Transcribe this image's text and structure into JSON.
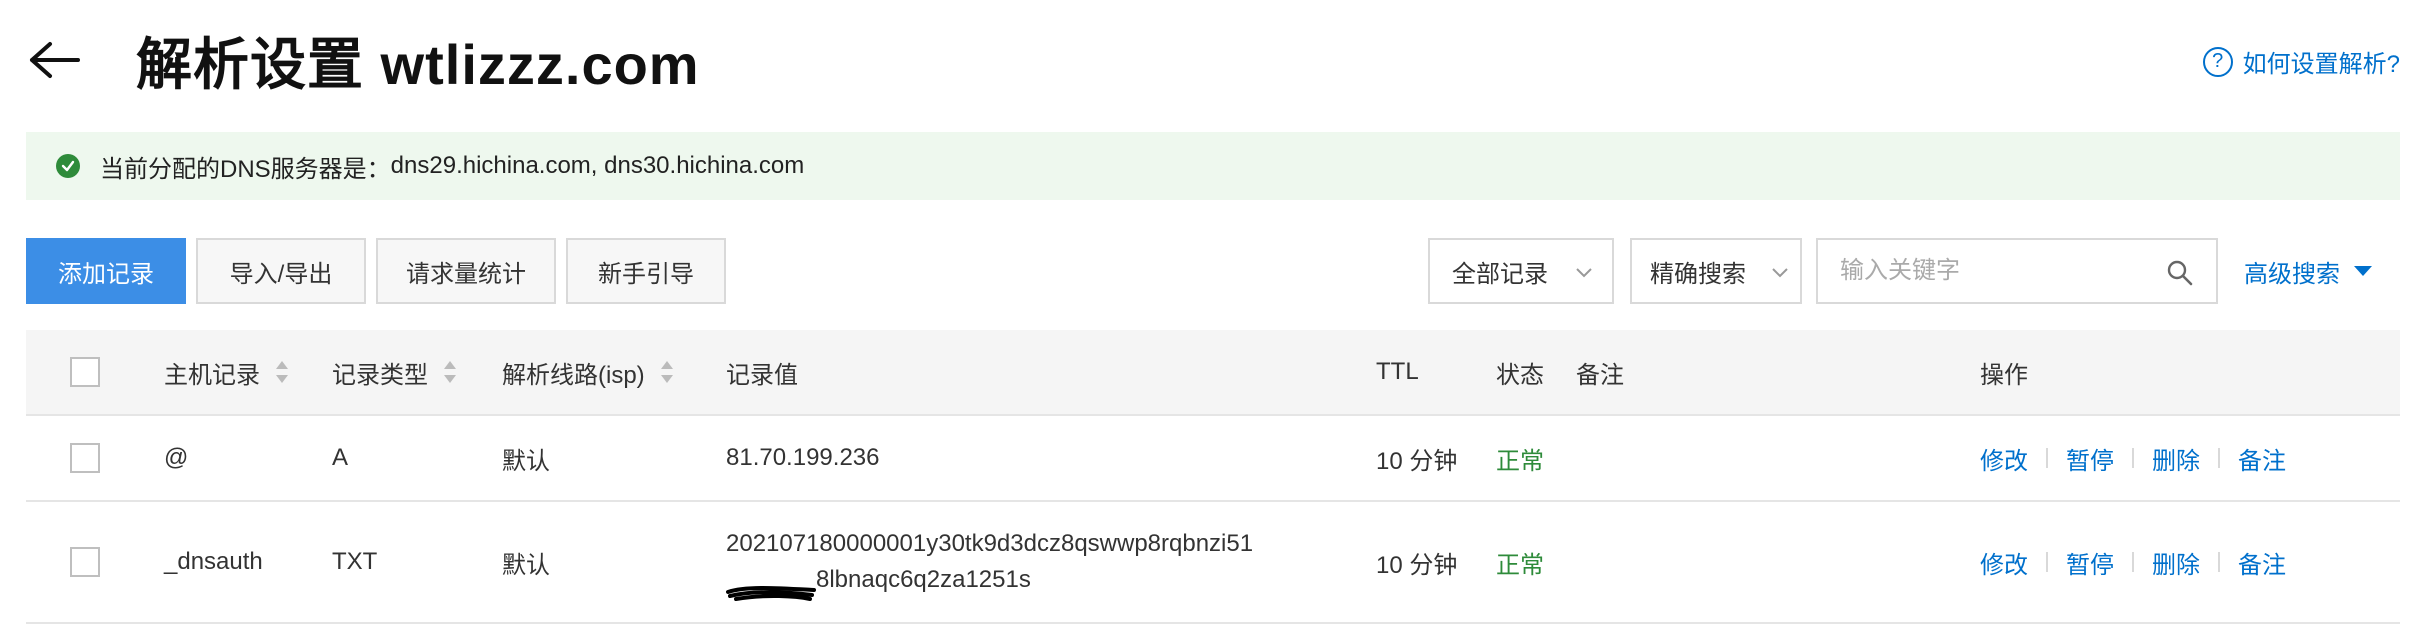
{
  "header": {
    "title": "解析设置 wtlizzz.com",
    "help_link": "如何设置解析?"
  },
  "banner": {
    "label": "当前分配的DNS服务器是：",
    "servers": "dns29.hichina.com, dns30.hichina.com"
  },
  "toolbar": {
    "add_record": "添加记录",
    "import_export": "导入/导出",
    "request_stats": "请求量统计",
    "beginner_guide": "新手引导",
    "record_filter": "全部记录",
    "search_mode": "精确搜索",
    "search_placeholder": "输入关键字",
    "search_value": "",
    "advanced_search": "高级搜索"
  },
  "table": {
    "columns": {
      "host": "主机记录",
      "type": "记录类型",
      "line": "解析线路(isp)",
      "value": "记录值",
      "ttl": "TTL",
      "status": "状态",
      "remark": "备注",
      "actions": "操作"
    },
    "rows": [
      {
        "host": "@",
        "type": "A",
        "line": "默认",
        "value_line1": "81.70.199.236",
        "value_line2": "",
        "ttl": "10 分钟",
        "status": "正常",
        "remark": ""
      },
      {
        "host": "_dnsauth",
        "type": "TXT",
        "line": "默认",
        "value_line1": "202107180000001y30tk9d3dcz8qswwp8rqbnzi51",
        "value_line2": "8lbnaqc6q2za1251s",
        "ttl": "10 分钟",
        "status": "正常",
        "remark": ""
      }
    ],
    "actions": {
      "edit": "修改",
      "pause": "暂停",
      "delete": "删除",
      "remark": "备注"
    }
  },
  "icons": {
    "back": "back-arrow-icon",
    "help": "question-circle-icon",
    "ok": "check-circle-icon",
    "search": "search-icon",
    "sort": "sort-icon",
    "chevron": "chevron-down-icon"
  },
  "colors": {
    "primary": "#3c8ee6",
    "link": "#0070cc",
    "success": "#2e8b3a",
    "banner_bg": "#eef8ee"
  }
}
